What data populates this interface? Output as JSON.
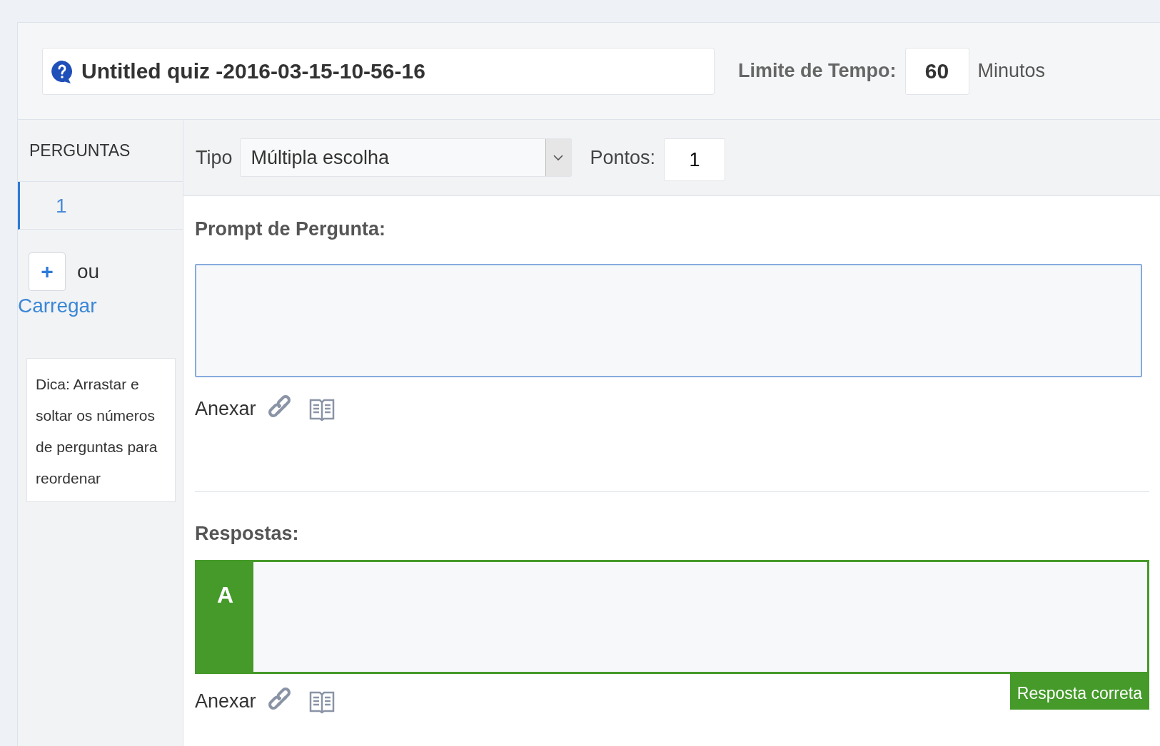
{
  "quiz": {
    "title": "Untitled quiz -2016-03-15-10-56-16",
    "time_limit_label": "Limite de Tempo:",
    "time_limit": "60",
    "time_unit": "Minutos"
  },
  "sidebar": {
    "heading": "PERGUNTAS",
    "questions": [
      {
        "label": "1",
        "selected": true
      }
    ],
    "add_button": "+",
    "add_or": "ou",
    "upload_link": "Carregar",
    "tip": "Dica: Arrastar e soltar os números de perguntas para reordenar"
  },
  "question": {
    "type_label": "Tipo",
    "type_value": "Múltipla escolha",
    "points_label": "Pontos:",
    "points": "1",
    "prompt_label": "Prompt de Pergunta:",
    "prompt_attach_label": "Anexar",
    "answers_label": "Respostas:",
    "answers": [
      {
        "letter": "A",
        "correct": true,
        "correct_label": "Resposta correta",
        "attach_label": "Anexar"
      }
    ]
  }
}
